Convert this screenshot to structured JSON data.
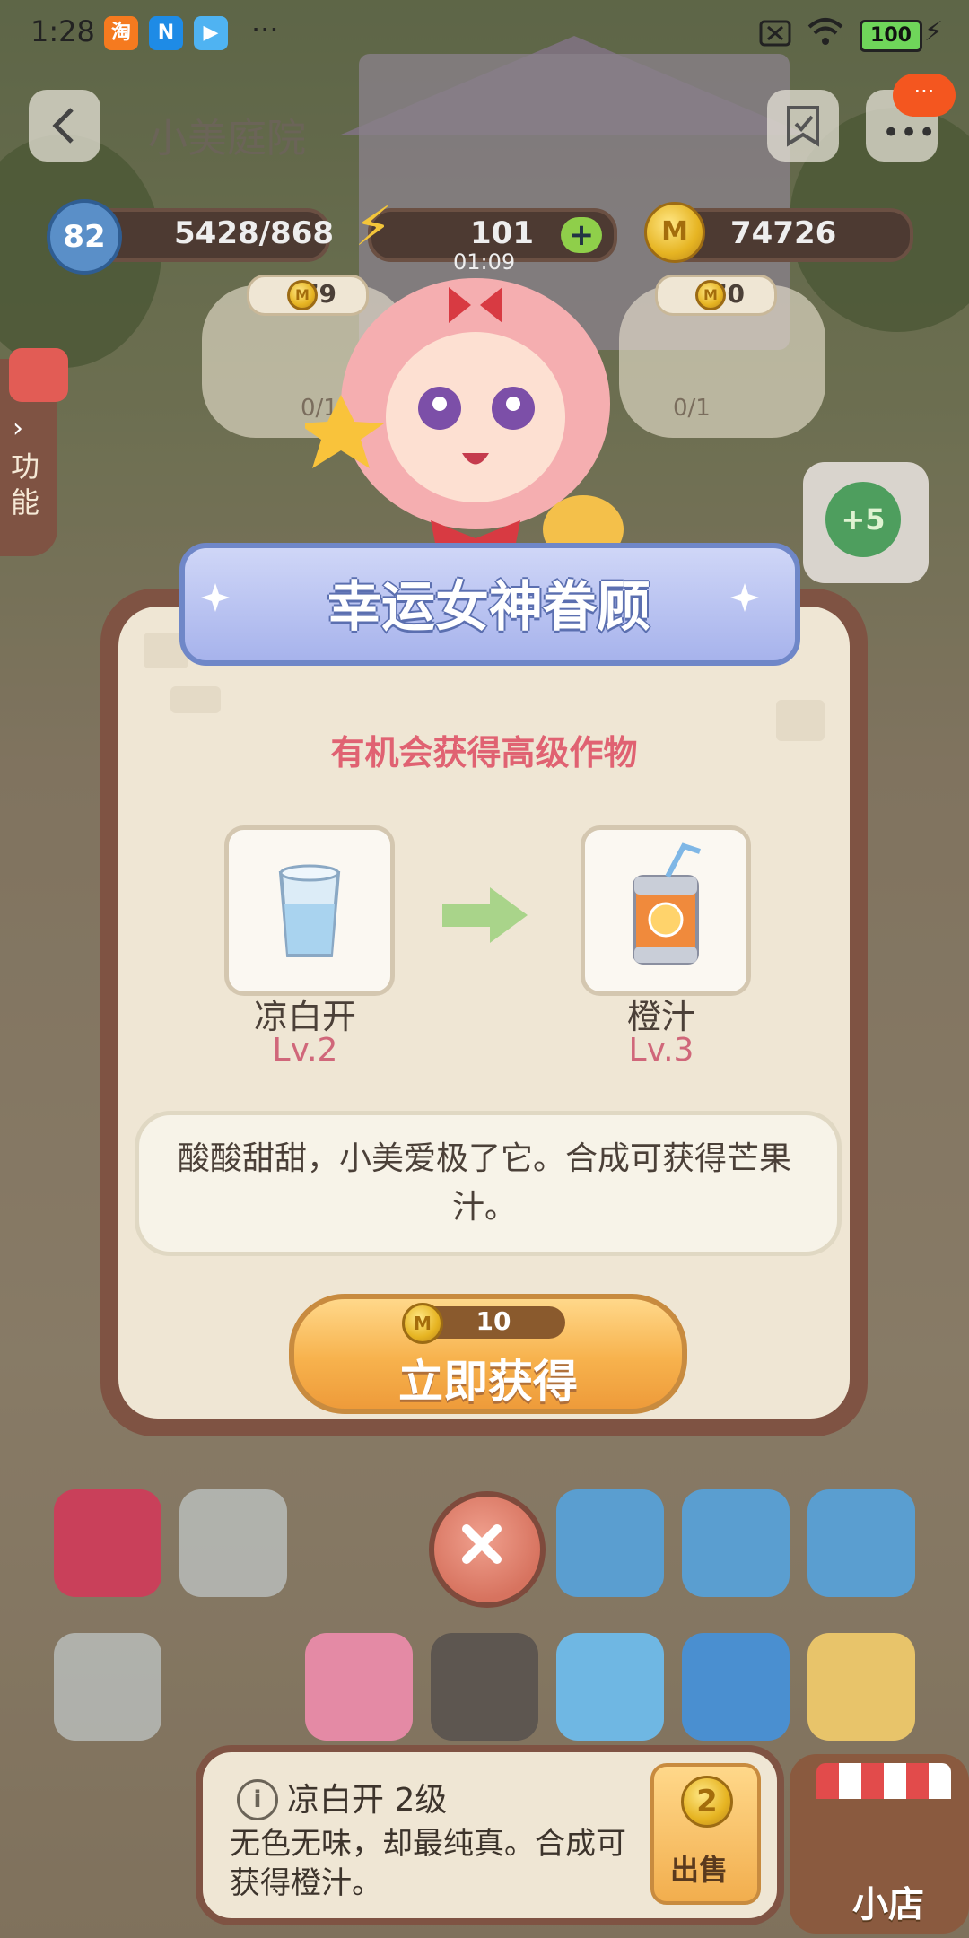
{
  "status_bar": {
    "time": "1:28",
    "app_badges": [
      "淘",
      "N",
      "▶"
    ],
    "more": "···",
    "battery": "100"
  },
  "header": {
    "title": "小美庭院",
    "level": "82",
    "exp": "5428/868",
    "energy": "101",
    "energy_timer": "01:09",
    "coins": "74726",
    "side_menu_label": "功能"
  },
  "orders": [
    {
      "price": "79",
      "progress": "0/1"
    },
    {
      "price": "70",
      "progress": "0/1"
    }
  ],
  "side_reward": "+5",
  "modal": {
    "title": "幸运女神眷顾",
    "subtitle": "有机会获得高级作物",
    "from_item": {
      "name": "凉白开",
      "level": "Lv.2"
    },
    "to_item": {
      "name": "橙汁",
      "level": "Lv.3"
    },
    "description": "酸酸甜甜，小美爱极了它。合成可获得芒果汁。",
    "button_label": "立即获得",
    "button_cost": "10"
  },
  "info_bar": {
    "title": "凉白开 2级",
    "description": "无色无味，却最纯真。合成可获得橙汁。",
    "sell_price": "2",
    "sell_label": "出售"
  },
  "shop_label": "小店",
  "colors": {
    "modal_border": "#7f5343",
    "modal_bg": "#efe6d4",
    "title_banner": "#a7b3ec",
    "level_text": "#d0677a",
    "subtitle_text": "#e06272",
    "button": "#f7b24d"
  }
}
